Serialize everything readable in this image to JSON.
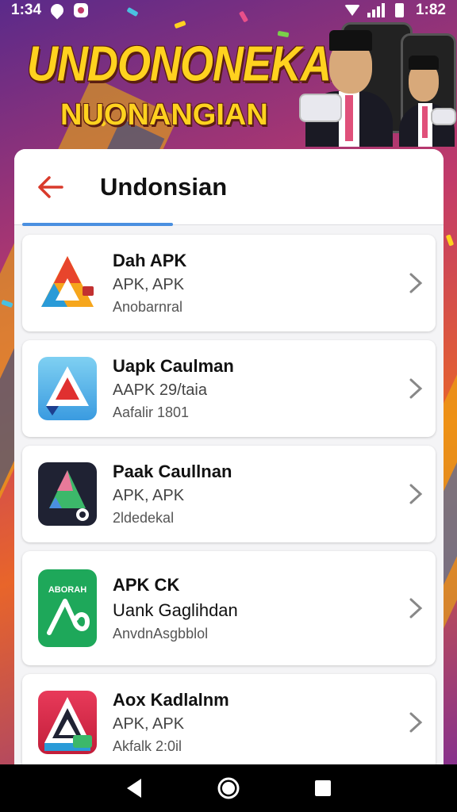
{
  "status_bar": {
    "time": "1:34",
    "clock_right": "1:82"
  },
  "banner": {
    "title": "UNDONONEKAN",
    "subtitle": "NUONANGIAN"
  },
  "header": {
    "title": "Undonsian"
  },
  "apps": [
    {
      "title": "Dah APK",
      "subtitle": "APK, APK",
      "meta": "Anobarnral",
      "icon": "multicolor-a-icon"
    },
    {
      "title": "Uapk Caulman",
      "subtitle": "AAPK 29/taia",
      "meta": "Aafalir 1801",
      "icon": "red-a-on-blue-icon"
    },
    {
      "title": "Paak Caullnan",
      "subtitle": "APK, APK",
      "meta": "2ldedekal",
      "icon": "dark-a-icon"
    },
    {
      "title": "APK CK",
      "subtitle": "Uank Gaglihdan",
      "meta": "AnvdnAsgbblol",
      "icon": "green-abrah-icon",
      "badge": "ABORAH"
    },
    {
      "title": "Aox Kadlalnm",
      "subtitle": "APK, APK",
      "meta": "Akfalk 2:0il",
      "icon": "red-a-icon"
    }
  ],
  "colors": {
    "accent_blue": "#4a8fe0",
    "back_arrow": "#d93a2b",
    "banner_text": "#ffd21f"
  }
}
